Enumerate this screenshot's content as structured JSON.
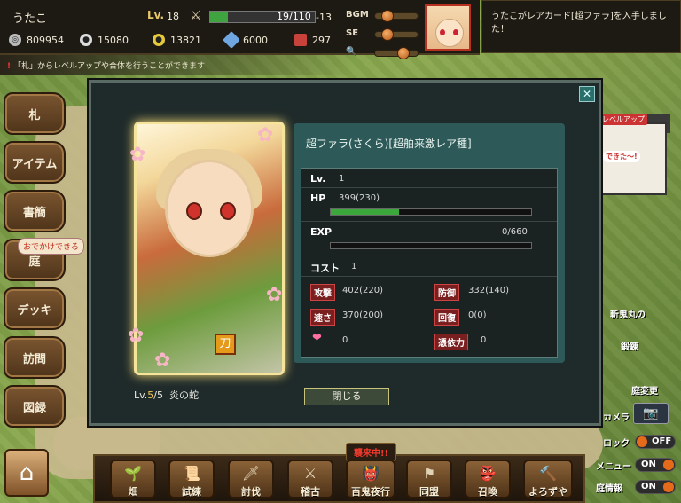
{
  "player": {
    "name": "うたこ",
    "level_label": "Lv.",
    "level": "18",
    "stamina": "19/110",
    "stamina_plus": "-13",
    "stamina_fraction": 0.17
  },
  "resources": [
    {
      "icon": "coin-ring-icon",
      "value": "809954"
    },
    {
      "icon": "silver-coin-icon",
      "value": "15080"
    },
    {
      "icon": "gold-coin-icon",
      "value": "13821"
    },
    {
      "icon": "diamond-icon",
      "value": "6000"
    },
    {
      "icon": "ticket-icon",
      "value": "297"
    }
  ],
  "settings": {
    "bgm_label": "BGM",
    "se_label": "SE",
    "zoom_icon": "magnifier-icon",
    "bgm_level": 0.2,
    "se_level": 0.2,
    "zoom_level": 0.7
  },
  "notice": "うたこがレアカード[超ファラ]を入手しました！",
  "tip": {
    "prefix": "「札」からレベルアップや合体を行うことができます"
  },
  "left_menu": [
    "札",
    "アイテム",
    "書簡",
    "庭",
    "デッキ",
    "訪問",
    "図録"
  ],
  "outing_badge": "おでかけできる",
  "card": {
    "title": "超ファラ(さくら)[超舶来激レア種]",
    "lv_label": "Lv.",
    "lv_value": "1",
    "hp_label": "HP",
    "hp_value": "399(230)",
    "hp_fraction": 0.34,
    "exp_label": "EXP",
    "exp_value": "0/660",
    "exp_fraction": 0.0,
    "cost_label": "コスト",
    "cost_value": "1",
    "attack_label": "攻撃",
    "attack_value": "402(220)",
    "defense_label": "防御",
    "defense_value": "332(140)",
    "speed_label": "速さ",
    "speed_value": "370(200)",
    "recover_label": "回復",
    "recover_value": "0(0)",
    "heart_value": "0",
    "possession_label": "憑依力",
    "possession_value": "0",
    "info_prefix": "Lv.",
    "info_cur": "5",
    "info_max": "/5",
    "info_skill": "炎の蛇",
    "emblem": "刀"
  },
  "dialog": {
    "close_label": "閉じる",
    "x_label": "✕"
  },
  "dock": {
    "attack_badge": "襲来中!!",
    "buttons": [
      "畑",
      "試練",
      "討伐",
      "稽古",
      "百鬼夜行",
      "同盟",
      "召喚",
      "よろずや"
    ]
  },
  "right_controls": {
    "camera_label": "カメラ",
    "lock_label": "ロック",
    "lock_state": "OFF",
    "menu_label": "メニュー",
    "menu_state": "ON",
    "garden_label": "庭情報",
    "garden_state": "ON"
  },
  "npcs": {
    "sanehime": "斬鬼丸の",
    "sanehime2": "鍛錬",
    "niwa": "庭変更",
    "levelup": "レベルアップ",
    "dekita": "できた〜!"
  }
}
